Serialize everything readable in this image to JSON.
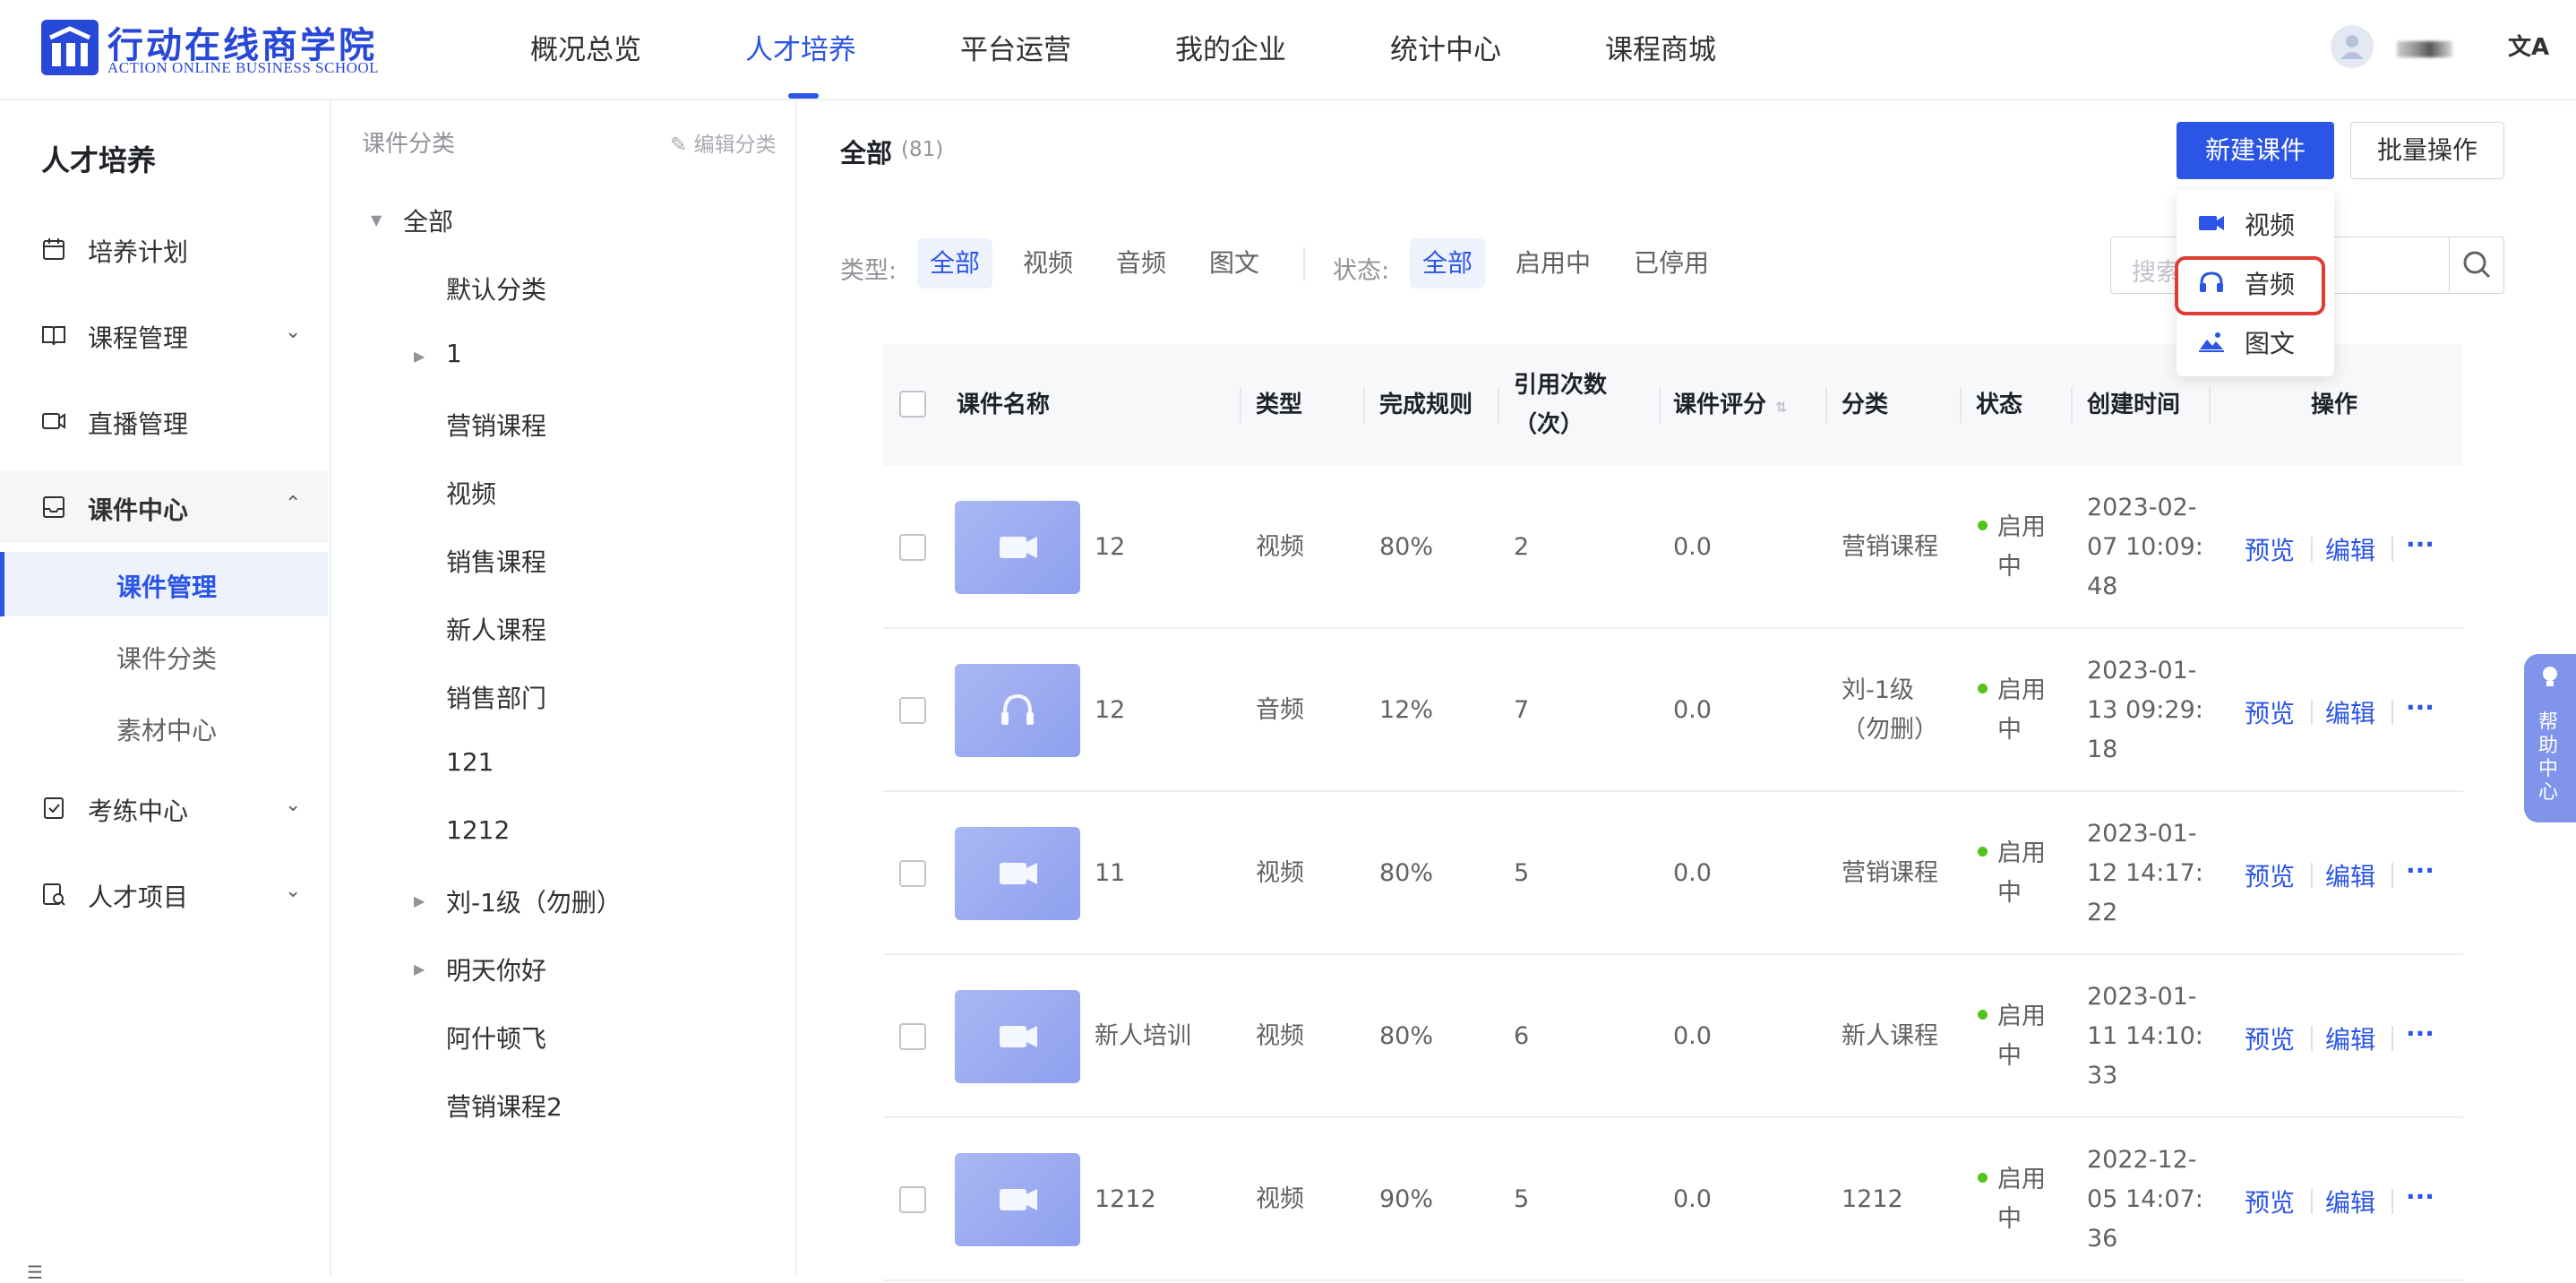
{
  "brand": {
    "title": "行动在线商学院",
    "subtitle": "ACTION ONLINE BUSINESS SCHOOL",
    "primary_color": "#2b55e6"
  },
  "top_nav": {
    "items": [
      "概况总览",
      "人才培养",
      "平台运营",
      "我的企业",
      "统计中心",
      "课程商城"
    ],
    "active": "人才培养"
  },
  "header_right": {
    "translate_icon": "文A"
  },
  "sidebar": {
    "title": "人才培养",
    "items": [
      {
        "label": "培养计划",
        "icon": "calendar-icon"
      },
      {
        "label": "课程管理",
        "icon": "book-icon",
        "expandable": true
      },
      {
        "label": "直播管理",
        "icon": "video-icon"
      },
      {
        "label": "课件中心",
        "icon": "inbox-icon",
        "expanded": true,
        "children": [
          {
            "label": "课件管理",
            "active": true
          },
          {
            "label": "课件分类"
          },
          {
            "label": "素材中心"
          }
        ]
      },
      {
        "label": "考练中心",
        "icon": "exam-icon",
        "expandable": true
      },
      {
        "label": "人才项目",
        "icon": "project-icon",
        "expandable": true
      }
    ]
  },
  "category_panel": {
    "header": "课件分类",
    "edit_label": "编辑分类",
    "root": "全部",
    "nodes": [
      "默认分类",
      "1",
      "营销课程",
      "视频",
      "销售课程",
      "新人课程",
      "销售部门",
      "121",
      "1212",
      "刘-1级（勿删）",
      "明天你好",
      "阿什顿飞",
      "营销课程2"
    ]
  },
  "main": {
    "title": "全部",
    "count": "(81)",
    "new_button": "新建课件",
    "batch_button": "批量操作",
    "type_filter": {
      "label": "类型:",
      "options": [
        "全部",
        "视频",
        "音频",
        "图文"
      ],
      "active": "全部"
    },
    "status_filter": {
      "label": "状态:",
      "options": [
        "全部",
        "启用中",
        "已停用"
      ],
      "active": "全部"
    },
    "search_placeholder": "搜索"
  },
  "new_dropdown": {
    "items": [
      {
        "label": "视频",
        "icon": "video-camera-icon"
      },
      {
        "label": "音频",
        "icon": "headphones-icon",
        "highlighted": true
      },
      {
        "label": "图文",
        "icon": "image-icon"
      }
    ]
  },
  "table": {
    "columns": [
      "课件名称",
      "类型",
      "完成规则",
      "引用次数（次）",
      "课件评分",
      "分类",
      "状态",
      "创建时间",
      "操作"
    ],
    "rows": [
      {
        "name": "12",
        "thumb": "video-camera-icon",
        "type": "视频",
        "rule": "80%",
        "refs": "2",
        "score": "0.0",
        "category": "营销课程",
        "status": "启用中",
        "created": "2023-02-07 10:09:48"
      },
      {
        "name": "12",
        "thumb": "headphones-icon",
        "type": "音频",
        "rule": "12%",
        "refs": "7",
        "score": "0.0",
        "category": "刘-1级（勿删）",
        "status": "启用中",
        "created": "2023-01-13 09:29:18"
      },
      {
        "name": "11",
        "thumb": "video-camera-icon",
        "type": "视频",
        "rule": "80%",
        "refs": "5",
        "score": "0.0",
        "category": "营销课程",
        "status": "启用中",
        "created": "2023-01-12 14:17:22"
      },
      {
        "name": "新人培训",
        "thumb": "video-camera-icon",
        "type": "视频",
        "rule": "80%",
        "refs": "6",
        "score": "0.0",
        "category": "新人课程",
        "status": "启用中",
        "created": "2023-01-11 14:10:33"
      },
      {
        "name": "1212",
        "thumb": "video-camera-icon",
        "type": "视频",
        "rule": "90%",
        "refs": "5",
        "score": "0.0",
        "category": "1212",
        "status": "启用中",
        "created": "2022-12-05 14:07:36"
      }
    ],
    "actions": {
      "preview": "预览",
      "edit": "编辑",
      "more": "···"
    }
  },
  "help_tab": {
    "label": "帮助中心"
  }
}
